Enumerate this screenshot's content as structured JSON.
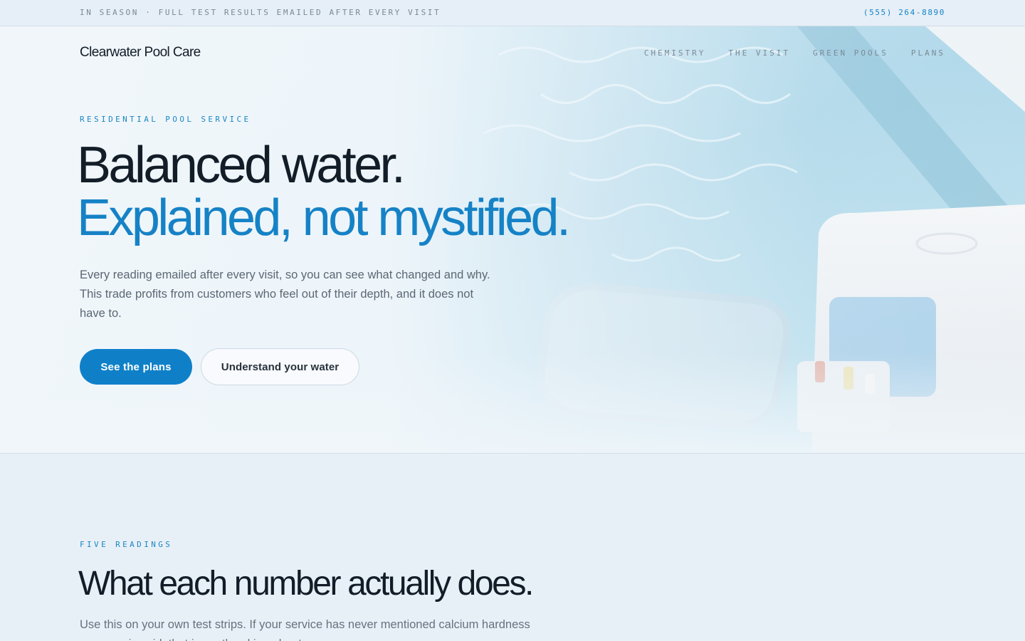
{
  "topbar": {
    "notice": "IN SEASON · FULL TEST RESULTS EMAILED AFTER EVERY VISIT",
    "phone": "(555) 264-8890"
  },
  "header": {
    "brand": "Clearwater Pool Care",
    "nav": [
      "CHEMISTRY",
      "THE VISIT",
      "GREEN POOLS",
      "PLANS"
    ]
  },
  "hero": {
    "eyebrow": "RESIDENTIAL POOL SERVICE",
    "headline_line1": "Balanced water.",
    "headline_line2": "Explained, not mystified.",
    "lede": "Every reading emailed after every visit, so you can see what changed and why. This trade profits from customers who feel out of their depth, and it does not have to.",
    "primary_cta": "See the plans",
    "secondary_cta": "Understand your water"
  },
  "readings": {
    "eyebrow": "FIVE READINGS",
    "title": "What each number actually does.",
    "lede": "Use this on your own test strips. If your service has never mentioned calcium hardness or cyanuric acid, that is worth asking about."
  },
  "colors": {
    "accent": "#1682c6",
    "button": "#0f80c8",
    "ink": "#121d28",
    "muted": "#5b6773",
    "background": "#e9f1f8"
  }
}
